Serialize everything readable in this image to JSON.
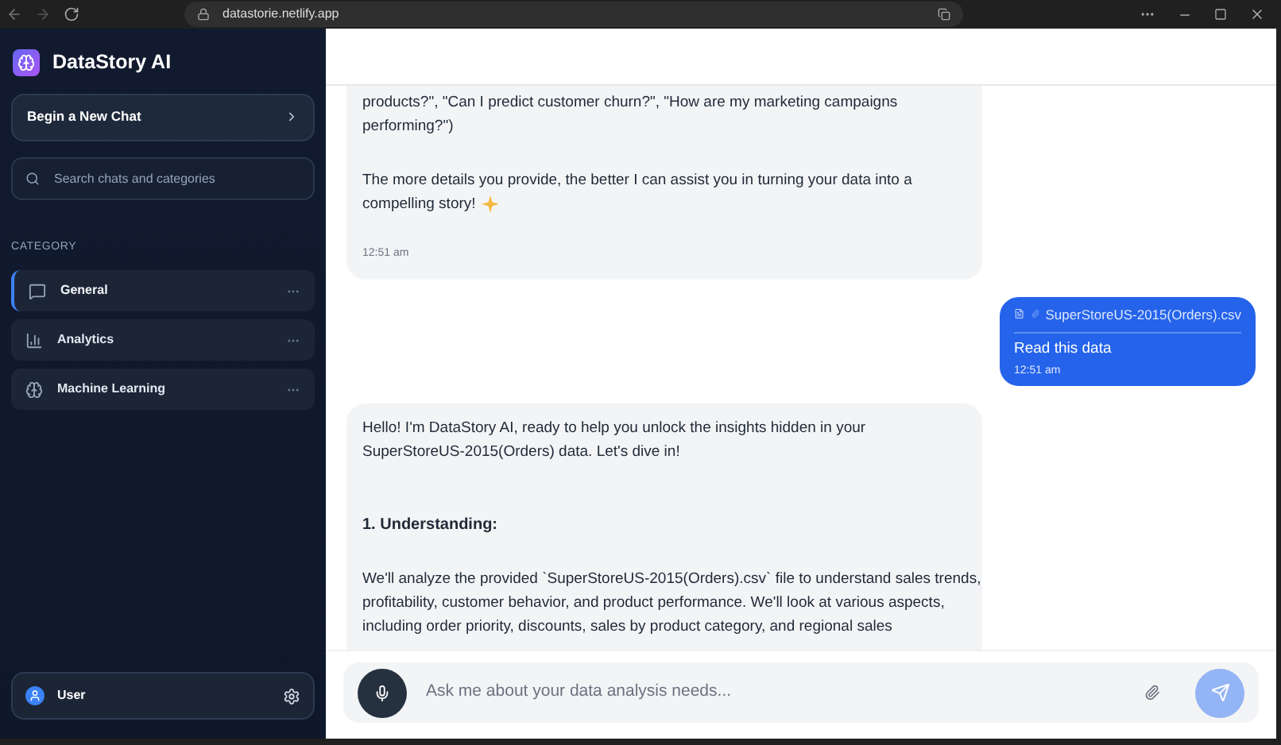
{
  "browser": {
    "url": "datastorie.netlify.app"
  },
  "sidebar": {
    "app_name": "DataStory AI",
    "new_chat": "Begin a New Chat",
    "search": {
      "placeholder": "Search chats and categories"
    },
    "category_heading": "CATEGORY",
    "categories": [
      {
        "label": "General",
        "kind": "chat",
        "selected": true
      },
      {
        "label": "Analytics",
        "kind": "chart",
        "selected": false
      },
      {
        "label": "Machine Learning",
        "kind": "brain",
        "selected": false
      }
    ],
    "user": "User"
  },
  "messages": [
    {
      "kind": "assistant",
      "paragraphs": [
        {
          "kind": "text",
          "lines": [
            "products?\", \"Can I predict customer churn?\", \"How are my marketing campaigns",
            "performing?\")"
          ]
        },
        {
          "kind": "text",
          "lines": [
            "The more details you provide, the better I can assist you in turning your data into a",
            "compelling story!"
          ],
          "sparkle": true
        }
      ],
      "time": "12:51 am"
    },
    {
      "kind": "user",
      "attachment": "SuperStoreUS-2015(Orders).csv",
      "text": "Read this data",
      "time": "12:51 am"
    },
    {
      "kind": "assistant",
      "paragraphs": [
        {
          "kind": "text",
          "lines": [
            "Hello! I'm DataStory AI, ready to help you unlock the insights hidden in your",
            "SuperStoreUS-2015(Orders) data. Let's dive in!"
          ]
        },
        {
          "kind": "gap"
        },
        {
          "kind": "heading",
          "lines": [
            "1. Understanding:"
          ]
        },
        {
          "kind": "text",
          "lines": [
            "We'll analyze the provided `SuperStoreUS-2015(Orders).csv` file to understand sales trends,",
            "profitability, customer behavior, and product performance. We'll look at various aspects,",
            "including order priority, discounts, sales by product category, and regional sales"
          ]
        }
      ]
    }
  ],
  "input": {
    "placeholder": "Ask me about your data analysis needs..."
  }
}
